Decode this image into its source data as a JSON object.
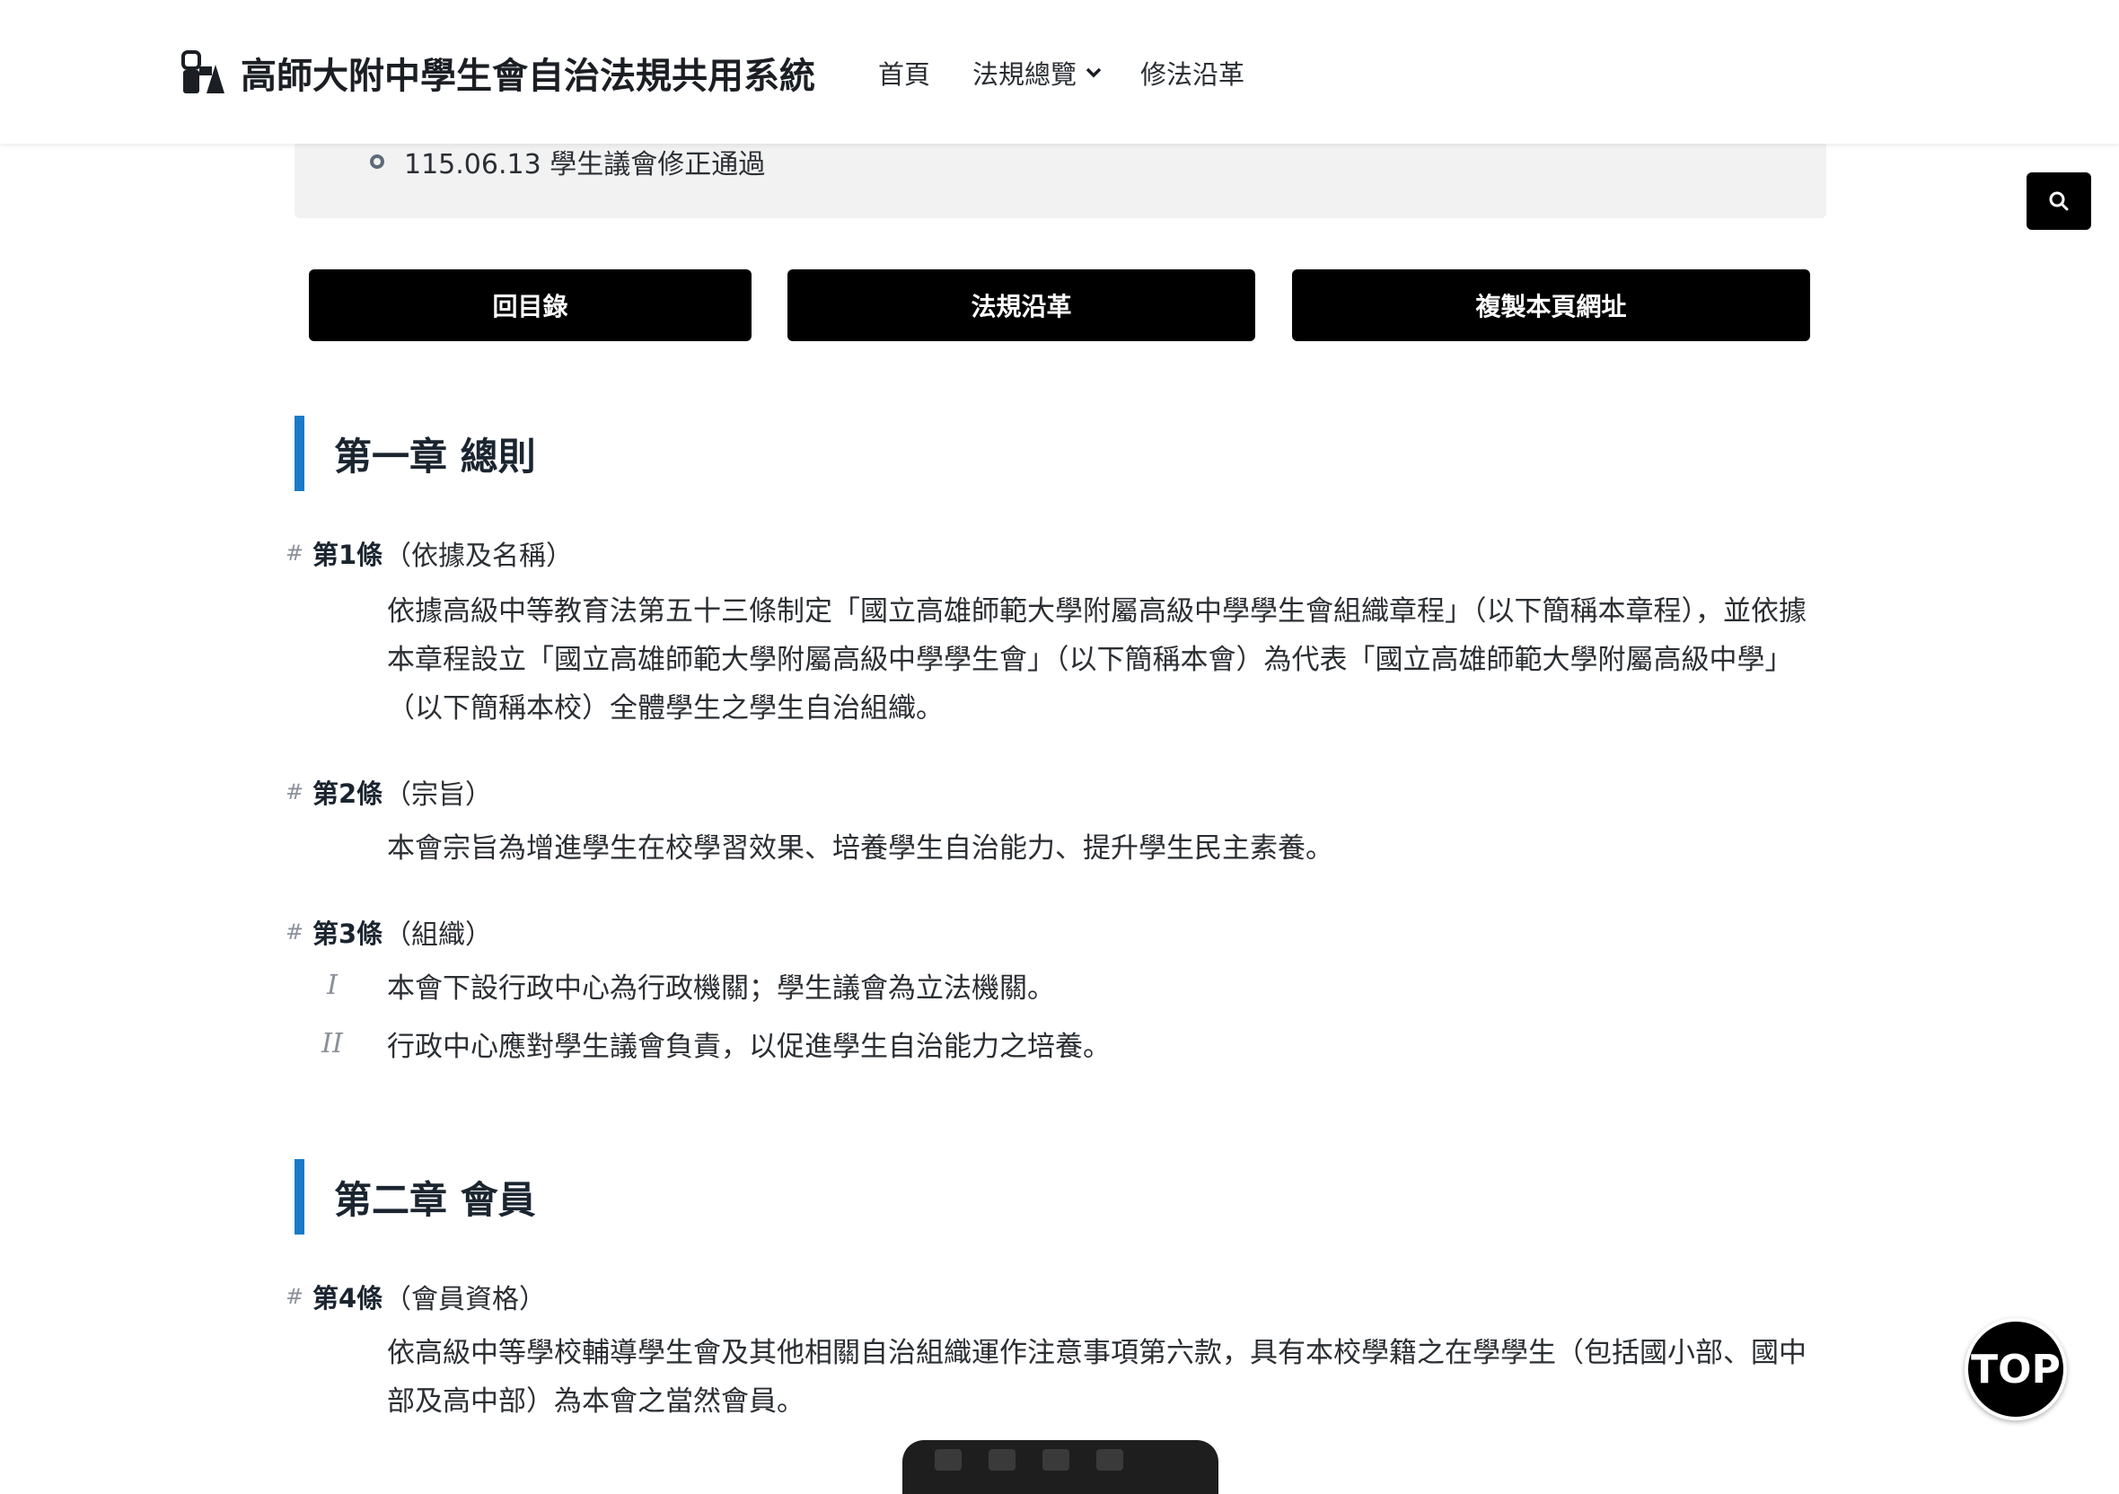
{
  "header": {
    "brand_title": "高師大附中學生會自治法規共用系統",
    "nav": [
      {
        "label": "首頁"
      },
      {
        "label": "法規總覽"
      },
      {
        "label": "修法沿革"
      }
    ]
  },
  "history": {
    "latest": "115.06.13 學生議會修正通過"
  },
  "buttons": {
    "toc": "回目錄",
    "history": "法規沿革",
    "copy_url": "複製本頁網址"
  },
  "chapters": [
    {
      "title": "第一章 總則"
    },
    {
      "title": "第二章 會員"
    }
  ],
  "articles": [
    {
      "hash": "#",
      "number": "第1條",
      "title": "（依據及名稱）",
      "text": "依據高級中等教育法第五十三條制定「國立高雄師範大學附屬高級中學學生會組織章程」（以下簡稱本章程），並依據本章程設立「國立高雄師範大學附屬高級中學學生會」（以下簡稱本會）為代表「國立高雄師範大學附屬高級中學」（以下簡稱本校）全體學生之學生自治組織。"
    },
    {
      "hash": "#",
      "number": "第2條",
      "title": "（宗旨）",
      "text": "本會宗旨為增進學生在校學習效果、培養學生自治能力、提升學生民主素養。"
    },
    {
      "hash": "#",
      "number": "第3條",
      "title": "（組織）",
      "clauses": [
        {
          "num": "I",
          "text": "本會下設行政中心為行政機關；學生議會為立法機關。"
        },
        {
          "num": "II",
          "text": "行政中心應對學生議會負責，以促進學生自治能力之培養。"
        }
      ]
    },
    {
      "hash": "#",
      "number": "第4條",
      "title": "（會員資格）",
      "text": "依高級中等學校輔導學生會及其他相關自治組織運作注意事項第六款，具有本校學籍之在學學生（包括國小部、國中部及高中部）為本會之當然會員。"
    }
  ],
  "floating": {
    "top_label": "TOP"
  },
  "icons": {
    "logo": "building-logo-icon",
    "search": "search-icon",
    "dropdown": "chevron-down-icon"
  }
}
